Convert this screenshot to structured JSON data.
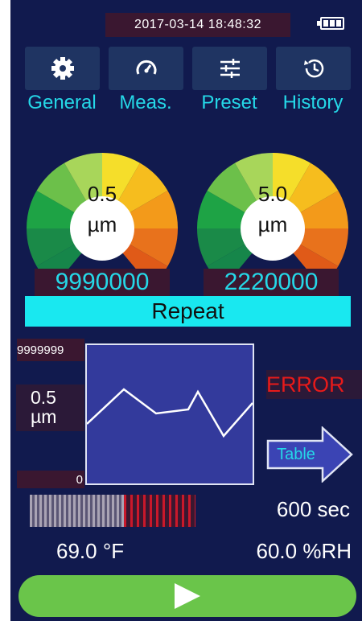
{
  "status": {
    "datetime": "2017-03-14 18:48:32",
    "battery_level": 1.0
  },
  "nav": [
    {
      "label": "General",
      "icon": "gear-icon"
    },
    {
      "label": "Meas.",
      "icon": "speedometer-icon"
    },
    {
      "label": "Preset",
      "icon": "sliders-icon"
    },
    {
      "label": "History",
      "icon": "history-icon"
    }
  ],
  "gauges": [
    {
      "size": "0.5",
      "unit": "µm",
      "count": "9990000"
    },
    {
      "size": "5.0",
      "unit": "µm",
      "count": "2220000"
    }
  ],
  "mode": "Repeat",
  "chart": {
    "y_max": "9999999",
    "y_min": "0",
    "size": "0.5",
    "unit": "µm"
  },
  "error_text": "ERROR",
  "table_label": "Table",
  "progress": 0.57,
  "interval": "600 sec",
  "temperature": "69.0 °F",
  "humidity": "60.0 %RH",
  "colors": {
    "background": "#111a4e",
    "accent": "#25d8e8",
    "error": "#e81a1a",
    "start": "#6ac54a"
  }
}
